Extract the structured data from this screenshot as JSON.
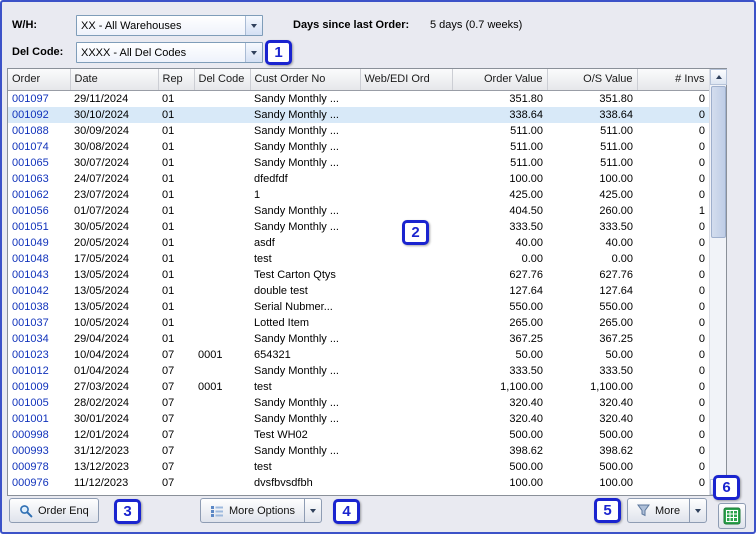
{
  "filters": {
    "wh_label": "W/H:",
    "wh_value": "XX - All Warehouses",
    "del_label": "Del Code:",
    "del_value": "XXXX - All Del Codes",
    "days_label": "Days since last Order:",
    "days_value": "5 days (0.7 weeks)"
  },
  "table": {
    "columns": [
      "Order",
      "Date",
      "Rep",
      "Del Code",
      "Cust Order No",
      "Web/EDI Ord",
      "Order Value",
      "O/S Value",
      "# Invs"
    ],
    "selected_index": 1,
    "rows": [
      {
        "order": "001097",
        "date": "29/11/2024",
        "rep": "01",
        "del_code": "",
        "cust_order_no": "Sandy Monthly ...",
        "web_edi": "",
        "order_value": "351.80",
        "os_value": "351.80",
        "invs": "0"
      },
      {
        "order": "001092",
        "date": "30/10/2024",
        "rep": "01",
        "del_code": "",
        "cust_order_no": "Sandy Monthly ...",
        "web_edi": "",
        "order_value": "338.64",
        "os_value": "338.64",
        "invs": "0"
      },
      {
        "order": "001088",
        "date": "30/09/2024",
        "rep": "01",
        "del_code": "",
        "cust_order_no": "Sandy Monthly ...",
        "web_edi": "",
        "order_value": "511.00",
        "os_value": "511.00",
        "invs": "0"
      },
      {
        "order": "001074",
        "date": "30/08/2024",
        "rep": "01",
        "del_code": "",
        "cust_order_no": "Sandy Monthly ...",
        "web_edi": "",
        "order_value": "511.00",
        "os_value": "511.00",
        "invs": "0"
      },
      {
        "order": "001065",
        "date": "30/07/2024",
        "rep": "01",
        "del_code": "",
        "cust_order_no": "Sandy Monthly ...",
        "web_edi": "",
        "order_value": "511.00",
        "os_value": "511.00",
        "invs": "0"
      },
      {
        "order": "001063",
        "date": "24/07/2024",
        "rep": "01",
        "del_code": "",
        "cust_order_no": "dfedfdf",
        "web_edi": "",
        "order_value": "100.00",
        "os_value": "100.00",
        "invs": "0"
      },
      {
        "order": "001062",
        "date": "23/07/2024",
        "rep": "01",
        "del_code": "",
        "cust_order_no": "1",
        "web_edi": "",
        "order_value": "425.00",
        "os_value": "425.00",
        "invs": "0"
      },
      {
        "order": "001056",
        "date": "01/07/2024",
        "rep": "01",
        "del_code": "",
        "cust_order_no": "Sandy Monthly ...",
        "web_edi": "",
        "order_value": "404.50",
        "os_value": "260.00",
        "invs": "1"
      },
      {
        "order": "001051",
        "date": "30/05/2024",
        "rep": "01",
        "del_code": "",
        "cust_order_no": "Sandy Monthly ...",
        "web_edi": "",
        "order_value": "333.50",
        "os_value": "333.50",
        "invs": "0"
      },
      {
        "order": "001049",
        "date": "20/05/2024",
        "rep": "01",
        "del_code": "",
        "cust_order_no": "asdf",
        "web_edi": "",
        "order_value": "40.00",
        "os_value": "40.00",
        "invs": "0"
      },
      {
        "order": "001048",
        "date": "17/05/2024",
        "rep": "01",
        "del_code": "",
        "cust_order_no": "test",
        "web_edi": "",
        "order_value": "0.00",
        "os_value": "0.00",
        "invs": "0"
      },
      {
        "order": "001043",
        "date": "13/05/2024",
        "rep": "01",
        "del_code": "",
        "cust_order_no": "Test Carton Qtys",
        "web_edi": "",
        "order_value": "627.76",
        "os_value": "627.76",
        "invs": "0"
      },
      {
        "order": "001042",
        "date": "13/05/2024",
        "rep": "01",
        "del_code": "",
        "cust_order_no": "double test",
        "web_edi": "",
        "order_value": "127.64",
        "os_value": "127.64",
        "invs": "0"
      },
      {
        "order": "001038",
        "date": "13/05/2024",
        "rep": "01",
        "del_code": "",
        "cust_order_no": "Serial Nubmer...",
        "web_edi": "",
        "order_value": "550.00",
        "os_value": "550.00",
        "invs": "0"
      },
      {
        "order": "001037",
        "date": "10/05/2024",
        "rep": "01",
        "del_code": "",
        "cust_order_no": "Lotted Item",
        "web_edi": "",
        "order_value": "265.00",
        "os_value": "265.00",
        "invs": "0"
      },
      {
        "order": "001034",
        "date": "29/04/2024",
        "rep": "01",
        "del_code": "",
        "cust_order_no": "Sandy Monthly ...",
        "web_edi": "",
        "order_value": "367.25",
        "os_value": "367.25",
        "invs": "0"
      },
      {
        "order": "001023",
        "date": "10/04/2024",
        "rep": "07",
        "del_code": "0001",
        "cust_order_no": "654321",
        "web_edi": "",
        "order_value": "50.00",
        "os_value": "50.00",
        "invs": "0"
      },
      {
        "order": "001012",
        "date": "01/04/2024",
        "rep": "07",
        "del_code": "",
        "cust_order_no": "Sandy Monthly ...",
        "web_edi": "",
        "order_value": "333.50",
        "os_value": "333.50",
        "invs": "0"
      },
      {
        "order": "001009",
        "date": "27/03/2024",
        "rep": "07",
        "del_code": "0001",
        "cust_order_no": "test",
        "web_edi": "",
        "order_value": "1,100.00",
        "os_value": "1,100.00",
        "invs": "0"
      },
      {
        "order": "001005",
        "date": "28/02/2024",
        "rep": "07",
        "del_code": "",
        "cust_order_no": "Sandy Monthly ...",
        "web_edi": "",
        "order_value": "320.40",
        "os_value": "320.40",
        "invs": "0"
      },
      {
        "order": "001001",
        "date": "30/01/2024",
        "rep": "07",
        "del_code": "",
        "cust_order_no": "Sandy Monthly ...",
        "web_edi": "",
        "order_value": "320.40",
        "os_value": "320.40",
        "invs": "0"
      },
      {
        "order": "000998",
        "date": "12/01/2024",
        "rep": "07",
        "del_code": "",
        "cust_order_no": "Test WH02",
        "web_edi": "",
        "order_value": "500.00",
        "os_value": "500.00",
        "invs": "0"
      },
      {
        "order": "000993",
        "date": "31/12/2023",
        "rep": "07",
        "del_code": "",
        "cust_order_no": "Sandy Monthly ...",
        "web_edi": "",
        "order_value": "398.62",
        "os_value": "398.62",
        "invs": "0"
      },
      {
        "order": "000978",
        "date": "13/12/2023",
        "rep": "07",
        "del_code": "",
        "cust_order_no": "test",
        "web_edi": "",
        "order_value": "500.00",
        "os_value": "500.00",
        "invs": "0"
      },
      {
        "order": "000976",
        "date": "11/12/2023",
        "rep": "07",
        "del_code": "",
        "cust_order_no": "dvsfbvsdfbh",
        "web_edi": "",
        "order_value": "100.00",
        "os_value": "100.00",
        "invs": "0"
      }
    ]
  },
  "toolbar": {
    "order_enq_label": "Order Enq",
    "more_options_label": "More Options",
    "more_label": "More"
  },
  "annotations": [
    "1",
    "2",
    "3",
    "4",
    "5",
    "6"
  ]
}
